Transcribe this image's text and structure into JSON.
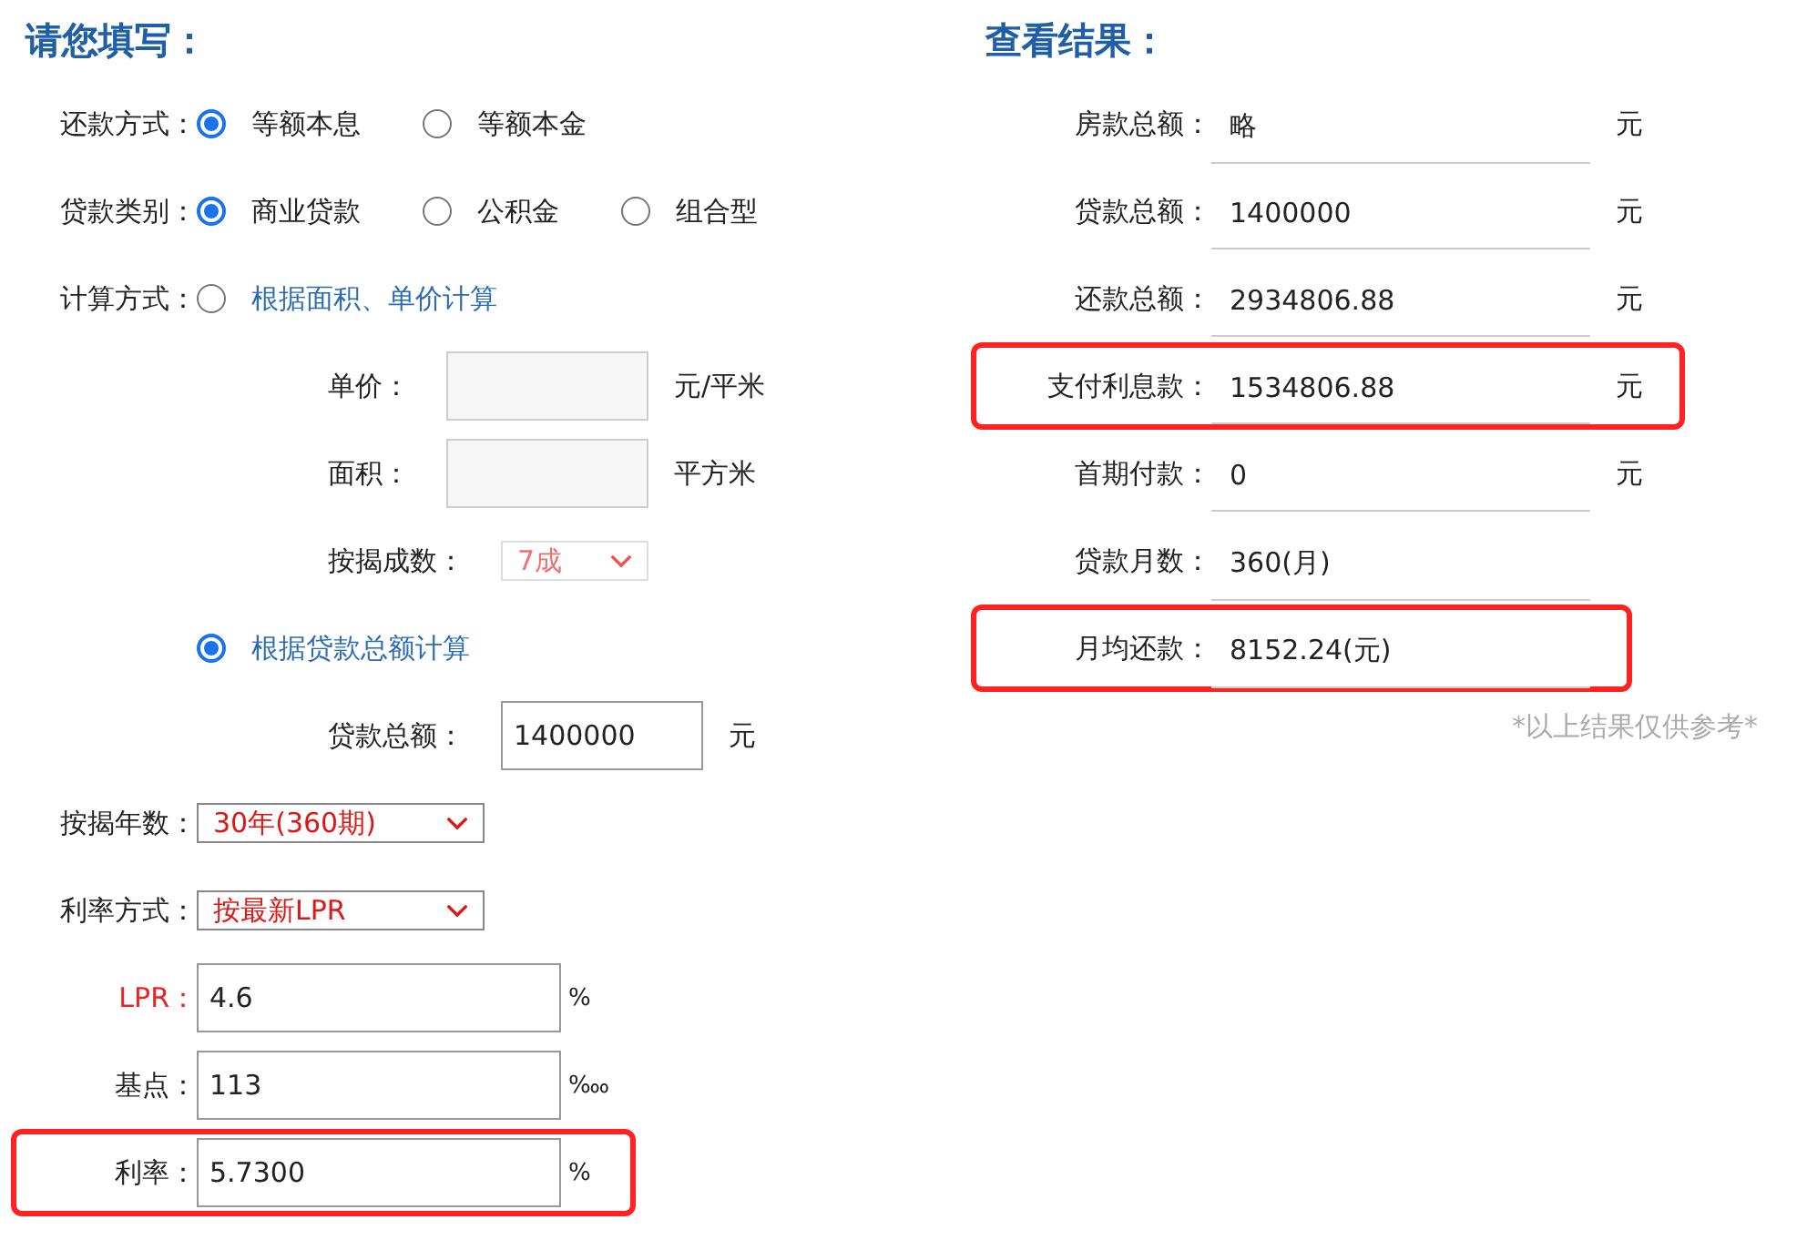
{
  "left": {
    "title": "请您填写：",
    "rows": [
      {
        "kind": "radio",
        "label": "还款方式：",
        "options": [
          {
            "label": "等额本息",
            "selected": true
          },
          {
            "label": "等额本金",
            "selected": false
          }
        ]
      },
      {
        "kind": "radio",
        "label": "贷款类别：",
        "options": [
          {
            "label": "商业贷款",
            "selected": true
          },
          {
            "label": "公积金",
            "selected": false
          },
          {
            "label": "组合型",
            "selected": false
          }
        ]
      },
      {
        "kind": "radio_link",
        "label": "计算方式：",
        "options": [
          {
            "label": "根据面积、单价计算",
            "selected": false
          }
        ]
      },
      {
        "kind": "sub_input",
        "label": "单价：",
        "disabled": true,
        "unit": "元/平米"
      },
      {
        "kind": "sub_input",
        "label": "面积：",
        "disabled": true,
        "unit": "平方米"
      },
      {
        "kind": "sub_select",
        "label": "按揭成数：",
        "disabled": true,
        "value": "7成"
      },
      {
        "kind": "radio_link",
        "options": [
          {
            "label": "根据贷款总额计算",
            "selected": true
          }
        ]
      },
      {
        "kind": "sub_input",
        "label": "贷款总额：",
        "disabled": false,
        "value": "1400000",
        "unit": "元"
      },
      {
        "kind": "select",
        "label": "按揭年数：",
        "value": "30年(360期)"
      },
      {
        "kind": "select",
        "label": "利率方式：",
        "value": "按最新LPR"
      },
      {
        "kind": "input",
        "label": "LPR：",
        "color": "#ee2222",
        "value": "4.6",
        "unit": "%",
        "highlighted": false
      },
      {
        "kind": "input",
        "label": "基点：",
        "value": "113",
        "unit": "‱",
        "highlighted": false
      },
      {
        "kind": "input",
        "label": "利率：",
        "value": "5.7300",
        "unit": "%",
        "highlighted": true
      }
    ]
  },
  "right": {
    "title": "查看结果：",
    "rows": [
      {
        "label": "房款总额：",
        "value": "略",
        "unit": "元",
        "highlighted": false
      },
      {
        "label": "贷款总额：",
        "value": "1400000",
        "unit": "元",
        "highlighted": false
      },
      {
        "label": "还款总额：",
        "value": "2934806.88",
        "unit": "元",
        "highlighted": false
      },
      {
        "label": "支付利息款：",
        "value": "1534806.88",
        "unit": "元",
        "highlighted": true
      },
      {
        "label": "首期付款：",
        "value": "0",
        "unit": "元",
        "highlighted": false
      },
      {
        "label": "贷款月数：",
        "value": "360(月)",
        "highlighted": false
      },
      {
        "label": "月均还款：",
        "value": "8152.24(元)",
        "highlighted": true
      }
    ],
    "note": "*以上结果仅供参考*"
  }
}
